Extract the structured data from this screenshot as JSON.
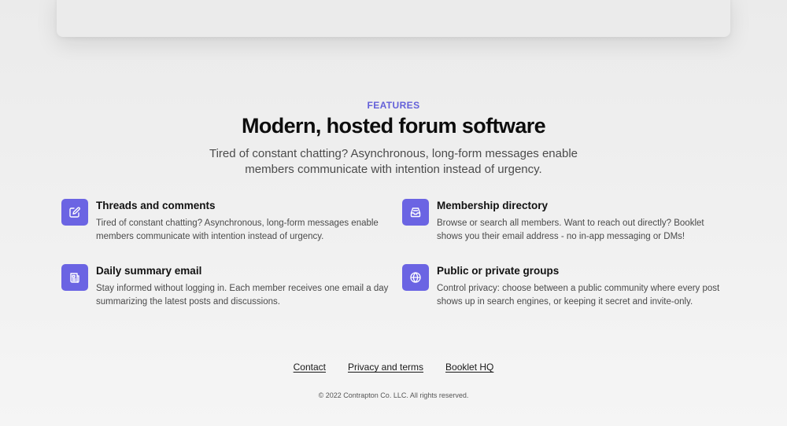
{
  "colors": {
    "accent": "#6b64e3",
    "eyebrow": "#6461d9",
    "background": "#f0f0f0"
  },
  "features_section": {
    "eyebrow": "FEATURES",
    "title": "Modern, hosted forum software",
    "subtitle": "Tired of constant chatting? Asynchronous, long-form messages enable members communicate with intention instead of urgency.",
    "items": [
      {
        "icon": "pencil-square-icon",
        "title": "Threads and comments",
        "description": "Tired of constant chatting? Asynchronous, long-form messages enable members communicate with intention instead of urgency."
      },
      {
        "icon": "inbox-icon",
        "title": "Membership directory",
        "description": "Browse or search all members. Want to reach out directly? Booklet shows you their email address - no in-app messaging or DMs!"
      },
      {
        "icon": "newspaper-icon",
        "title": "Daily summary email",
        "description": "Stay informed without logging in. Each member receives one email a day summarizing the latest posts and discussions."
      },
      {
        "icon": "globe-icon",
        "title": "Public or private groups",
        "description": "Control privacy: choose between a public community where every post shows up in search engines, or keeping it secret and invite-only."
      }
    ]
  },
  "footer": {
    "links": [
      "Contact",
      "Privacy and terms",
      "Booklet HQ"
    ],
    "copyright": "© 2022 Contrapton Co. LLC. All rights reserved."
  }
}
